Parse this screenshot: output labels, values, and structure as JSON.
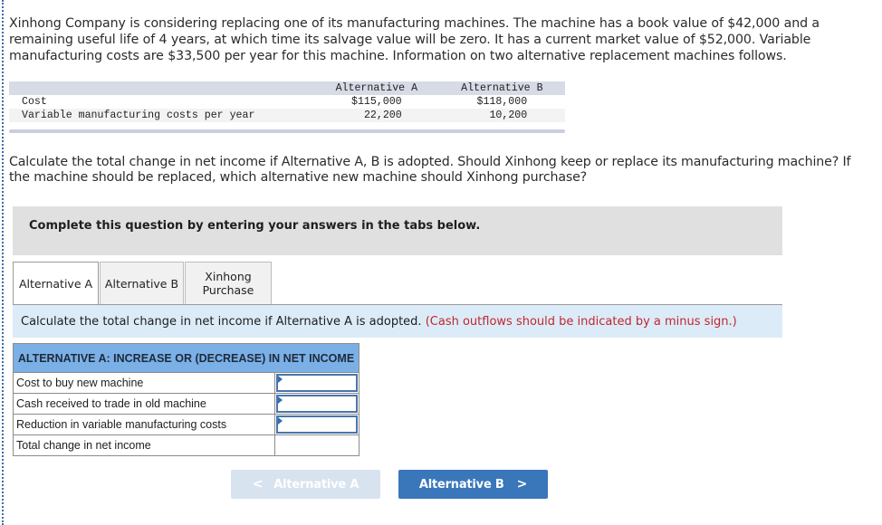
{
  "problem": {
    "intro": "Xinhong Company is considering replacing one of its manufacturing machines. The machine has a book value of $42,000 and a remaining useful life of 4 years, at which time its salvage value will be zero. It has a current market value of $52,000. Variable manufacturing costs are $33,500 per year for this machine. Information on two alternative replacement machines follows.",
    "given_table": {
      "columns": [
        "",
        "Alternative A",
        "Alternative B"
      ],
      "rows": [
        {
          "label": "Cost",
          "alt_a": "$115,000",
          "alt_b": "$118,000"
        },
        {
          "label": "Variable manufacturing costs per year",
          "alt_a": "22,200",
          "alt_b": "10,200"
        }
      ]
    },
    "question": "Calculate the total change in net income if Alternative A, B is adopted. Should Xinhong keep or replace its manufacturing machine? If the machine should be replaced, which alternative new machine should Xinhong purchase?"
  },
  "instructions": "Complete this question by entering your answers in the tabs below.",
  "tabs": [
    {
      "label": "Alternative A",
      "active": true
    },
    {
      "label": "Alternative B",
      "active": false
    },
    {
      "label": "Xinhong Purchase",
      "active": false
    }
  ],
  "panel": {
    "prompt": "Calculate the total change in net income if Alternative A is adopted.",
    "note": "(Cash outflows should be indicated by a minus sign.)",
    "table": {
      "header": "ALTERNATIVE A: INCREASE OR (DECREASE) IN NET INCOME",
      "rows": [
        {
          "label": "Cost to buy new machine",
          "value": "",
          "editable": true
        },
        {
          "label": "Cash received to trade in old machine",
          "value": "",
          "editable": true
        },
        {
          "label": "Reduction in variable manufacturing costs",
          "value": "",
          "editable": true
        },
        {
          "label": "Total change in net income",
          "value": "",
          "editable": false
        }
      ]
    }
  },
  "navigation": {
    "prev": {
      "label": "Alternative A",
      "icon": "chevron-left-icon",
      "glyph": "<",
      "enabled": false
    },
    "next": {
      "label": "Alternative B",
      "icon": "chevron-right-icon",
      "glyph": ">",
      "enabled": true
    }
  },
  "colors": {
    "accent": "#3a76ba",
    "header_blue": "#7ab0e6",
    "note_red": "#c0282d",
    "panel_bg": "#dcebf8"
  }
}
